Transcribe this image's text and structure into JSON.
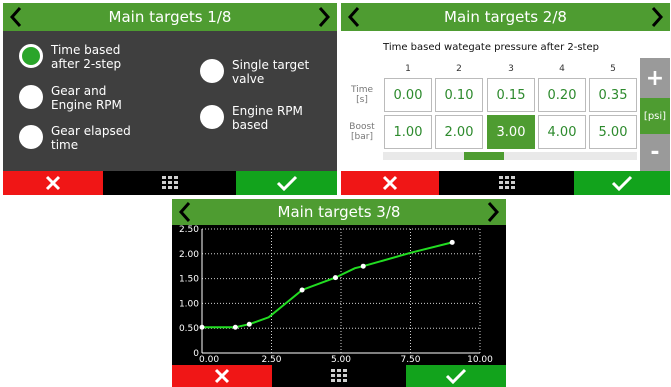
{
  "screen1": {
    "title": "Main targets 1/8",
    "options": [
      {
        "label": "Time based after 2-step",
        "lines": [
          "Time based",
          "after 2-step"
        ],
        "selected": true
      },
      {
        "label": "Gear and Engine RPM",
        "lines": [
          "Gear and",
          "Engine RPM"
        ],
        "selected": false
      },
      {
        "label": "Gear elapsed time",
        "lines": [
          "Gear elapsed",
          "time"
        ],
        "selected": false
      },
      {
        "label": "Single target valve",
        "lines": [
          "Single target",
          "valve"
        ],
        "selected": false
      },
      {
        "label": "Engine RPM based",
        "lines": [
          "Engine RPM",
          "based"
        ],
        "selected": false
      }
    ]
  },
  "screen2": {
    "title": "Main targets 2/8",
    "table_title": "Time based wategate pressure after 2-step",
    "columns": [
      "1",
      "2",
      "3",
      "4",
      "5"
    ],
    "row_labels": [
      {
        "lines": [
          "Time",
          "[s]"
        ]
      },
      {
        "lines": [
          "Boost",
          "[bar]"
        ]
      }
    ],
    "rows": [
      [
        "0.00",
        "0.10",
        "0.15",
        "0.20",
        "0.35"
      ],
      [
        "1.00",
        "2.00",
        "3.00",
        "4.00",
        "5.00"
      ]
    ],
    "active_cell": {
      "row": 1,
      "col": 2
    },
    "side_buttons": {
      "plus": "+",
      "unit": "[psi]",
      "minus": "-"
    },
    "scroll_position": 0.38
  },
  "screen3": {
    "title": "Main targets 3/8"
  },
  "chart_data": {
    "type": "line",
    "title": "",
    "xlabel": "",
    "ylabel": "",
    "xlim": [
      0,
      10
    ],
    "ylim": [
      0,
      2.5
    ],
    "x_ticks": [
      "0.00",
      "2.50",
      "5.00",
      "7.50",
      "10.00"
    ],
    "y_ticks": [
      "0",
      "0.50",
      "1.00",
      "1.50",
      "2.00",
      "2.50"
    ],
    "grid": true,
    "series": [
      {
        "points": [
          {
            "x": 0.0,
            "y": 0.52
          },
          {
            "x": 1.2,
            "y": 0.52
          },
          {
            "x": 1.7,
            "y": 0.58
          },
          {
            "x": 2.4,
            "y": 0.72
          },
          {
            "x": 3.6,
            "y": 1.27
          },
          {
            "x": 4.8,
            "y": 1.52
          },
          {
            "x": 5.5,
            "y": 1.71
          },
          {
            "x": 5.8,
            "y": 1.75
          },
          {
            "x": 7.5,
            "y": 2.02
          },
          {
            "x": 9.0,
            "y": 2.23
          }
        ],
        "markers": [
          0,
          1,
          2,
          4,
          5,
          7,
          9
        ],
        "color": "#22dd22"
      }
    ]
  },
  "colors": {
    "titlebar": "#4e9c31",
    "cancel": "#f01616",
    "ok": "#12a31c",
    "accent_text": "#2d8a2d"
  },
  "icons": {
    "prev": "chevron-left-icon",
    "next": "chevron-right-icon",
    "cancel": "close-icon",
    "menu": "grid-icon",
    "confirm": "check-icon"
  }
}
